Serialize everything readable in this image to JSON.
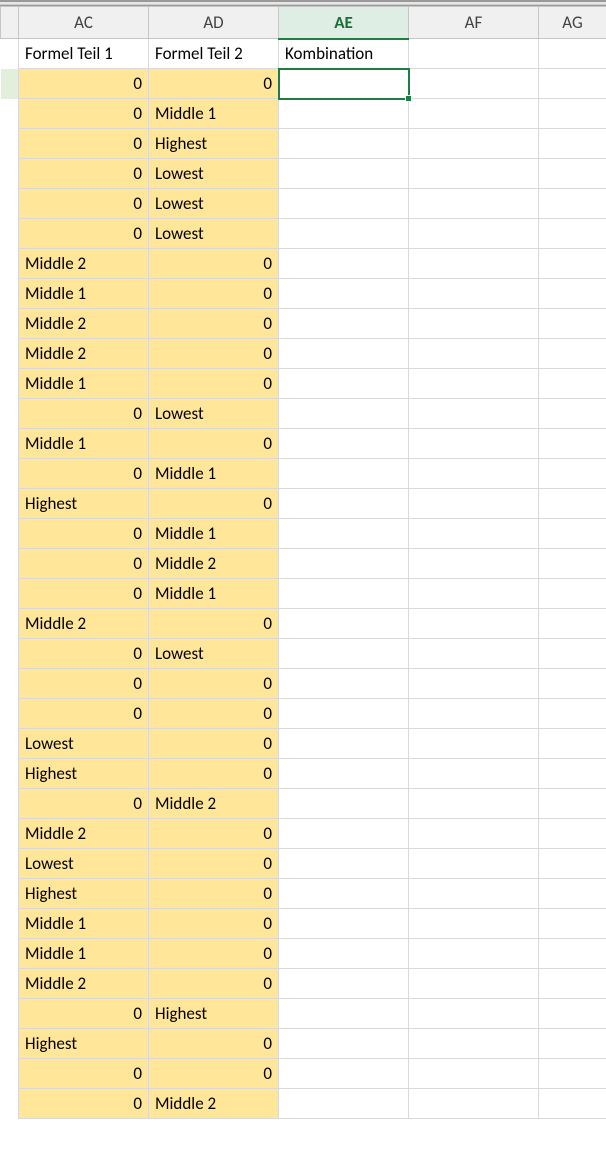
{
  "columns": [
    "AC",
    "AD",
    "AE",
    "AF",
    "AG"
  ],
  "selected_column_index": 2,
  "header_row": {
    "ac": "Formel Teil 1",
    "ad": "Formel Teil 2",
    "ae": "Kombination",
    "af": "",
    "ag": ""
  },
  "rows": [
    {
      "ac_text": "",
      "ac_num": "0",
      "ad_text": "",
      "ad_num": "0",
      "greenstub": true
    },
    {
      "ac_text": "",
      "ac_num": "0",
      "ad_text": "Middle 1",
      "ad_num": ""
    },
    {
      "ac_text": "",
      "ac_num": "0",
      "ad_text": "Highest",
      "ad_num": ""
    },
    {
      "ac_text": "",
      "ac_num": "0",
      "ad_text": "Lowest",
      "ad_num": ""
    },
    {
      "ac_text": "",
      "ac_num": "0",
      "ad_text": "Lowest",
      "ad_num": ""
    },
    {
      "ac_text": "",
      "ac_num": "0",
      "ad_text": "Lowest",
      "ad_num": ""
    },
    {
      "ac_text": "Middle 2",
      "ac_num": "",
      "ad_text": "",
      "ad_num": "0"
    },
    {
      "ac_text": "Middle 1",
      "ac_num": "",
      "ad_text": "",
      "ad_num": "0"
    },
    {
      "ac_text": "Middle 2",
      "ac_num": "",
      "ad_text": "",
      "ad_num": "0"
    },
    {
      "ac_text": "Middle 2",
      "ac_num": "",
      "ad_text": "",
      "ad_num": "0"
    },
    {
      "ac_text": "Middle 1",
      "ac_num": "",
      "ad_text": "",
      "ad_num": "0"
    },
    {
      "ac_text": "",
      "ac_num": "0",
      "ad_text": "Lowest",
      "ad_num": ""
    },
    {
      "ac_text": "Middle 1",
      "ac_num": "",
      "ad_text": "",
      "ad_num": "0"
    },
    {
      "ac_text": "",
      "ac_num": "0",
      "ad_text": "Middle 1",
      "ad_num": ""
    },
    {
      "ac_text": "Highest",
      "ac_num": "",
      "ad_text": "",
      "ad_num": "0"
    },
    {
      "ac_text": "",
      "ac_num": "0",
      "ad_text": "Middle 1",
      "ad_num": ""
    },
    {
      "ac_text": "",
      "ac_num": "0",
      "ad_text": "Middle 2",
      "ad_num": ""
    },
    {
      "ac_text": "",
      "ac_num": "0",
      "ad_text": "Middle 1",
      "ad_num": ""
    },
    {
      "ac_text": "Middle 2",
      "ac_num": "",
      "ad_text": "",
      "ad_num": "0"
    },
    {
      "ac_text": "",
      "ac_num": "0",
      "ad_text": "Lowest",
      "ad_num": ""
    },
    {
      "ac_text": "",
      "ac_num": "0",
      "ad_text": "",
      "ad_num": "0"
    },
    {
      "ac_text": "",
      "ac_num": "0",
      "ad_text": "",
      "ad_num": "0"
    },
    {
      "ac_text": "Lowest",
      "ac_num": "",
      "ad_text": "",
      "ad_num": "0"
    },
    {
      "ac_text": "Highest",
      "ac_num": "",
      "ad_text": "",
      "ad_num": "0"
    },
    {
      "ac_text": "",
      "ac_num": "0",
      "ad_text": "Middle 2",
      "ad_num": ""
    },
    {
      "ac_text": "Middle 2",
      "ac_num": "",
      "ad_text": "",
      "ad_num": "0"
    },
    {
      "ac_text": "Lowest",
      "ac_num": "",
      "ad_text": "",
      "ad_num": "0"
    },
    {
      "ac_text": "Highest",
      "ac_num": "",
      "ad_text": "",
      "ad_num": "0"
    },
    {
      "ac_text": "Middle 1",
      "ac_num": "",
      "ad_text": "",
      "ad_num": "0"
    },
    {
      "ac_text": "Middle 1",
      "ac_num": "",
      "ad_text": "",
      "ad_num": "0"
    },
    {
      "ac_text": "Middle 2",
      "ac_num": "",
      "ad_text": "",
      "ad_num": "0"
    },
    {
      "ac_text": "",
      "ac_num": "0",
      "ad_text": "Highest",
      "ad_num": ""
    },
    {
      "ac_text": "Highest",
      "ac_num": "",
      "ad_text": "",
      "ad_num": "0"
    },
    {
      "ac_text": "",
      "ac_num": "0",
      "ad_text": "",
      "ad_num": "0"
    },
    {
      "ac_text": "",
      "ac_num": "0",
      "ad_text": "Middle 2",
      "ad_num": ""
    }
  ],
  "colors": {
    "highlight": "#ffe699",
    "selection": "#1e7e44"
  }
}
